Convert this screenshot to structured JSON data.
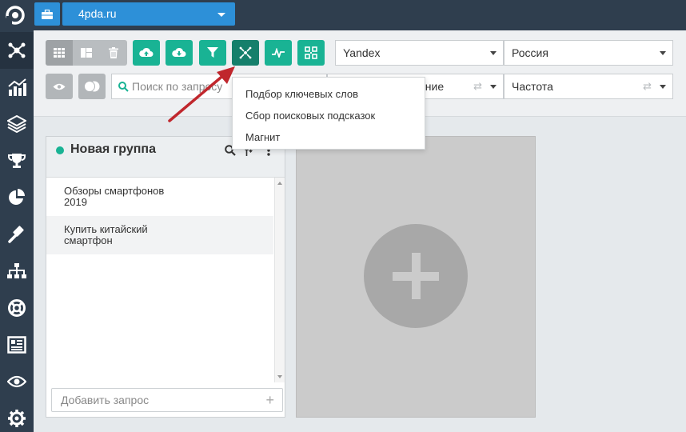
{
  "project": {
    "name": "4pda.ru"
  },
  "sidebar": {
    "items": [
      {
        "icon": "network-icon",
        "active": true
      },
      {
        "icon": "chart-icon"
      },
      {
        "icon": "layers-icon"
      },
      {
        "icon": "trophy-icon"
      },
      {
        "icon": "pie-chart-icon"
      },
      {
        "icon": "gavel-icon"
      },
      {
        "icon": "sitemap-icon"
      },
      {
        "icon": "lifebuoy-icon"
      },
      {
        "icon": "report-icon"
      },
      {
        "icon": "eye-icon"
      },
      {
        "icon": "gear-icon"
      }
    ]
  },
  "toolbar": {
    "search_engine": "Yandex",
    "region": "Россия",
    "search_placeholder": "Поиск по запросу",
    "occurrence_fragment": "ение",
    "frequency": "Частота"
  },
  "menu": {
    "items": [
      "Подбор ключевых слов",
      "Сбор поисковых подсказок",
      "Магнит"
    ]
  },
  "group": {
    "title": "Новая группа",
    "rows": [
      {
        "line1": "Обзоры смартфонов",
        "line2": "2019"
      },
      {
        "line1": "Купить китайский",
        "line2": "смартфон"
      }
    ],
    "add_placeholder": "Добавить запрос"
  },
  "colors": {
    "accent": "#19b394",
    "accent_active": "#157f6b",
    "brand_blue": "#2d90d8",
    "sidebar_bg": "#2f3e4e",
    "arrow": "#c0272d"
  }
}
